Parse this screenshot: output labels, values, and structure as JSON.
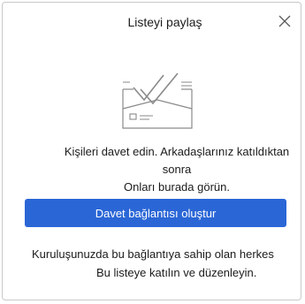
{
  "dialog": {
    "title": "Listeyi paylaş",
    "close_icon": "close-icon",
    "illustration_icon": "envelope-checkmark-illustration",
    "invite_line_1": "Kişileri davet edin. Arkadaşlarınız katıldıktan sonra",
    "invite_line_2": "Onları burada görün.",
    "create_link_button": "Davet bağlantısı oluştur",
    "org_line_1": "Kuruluşunuzda bu bağlantıya sahip olan herkes",
    "org_line_2": "Bu listeye katılın ve düzenleyin.",
    "colors": {
      "accent": "#2a66d6",
      "border": "#c9c9c9",
      "illustration_stroke": "#8a8a8a"
    }
  }
}
